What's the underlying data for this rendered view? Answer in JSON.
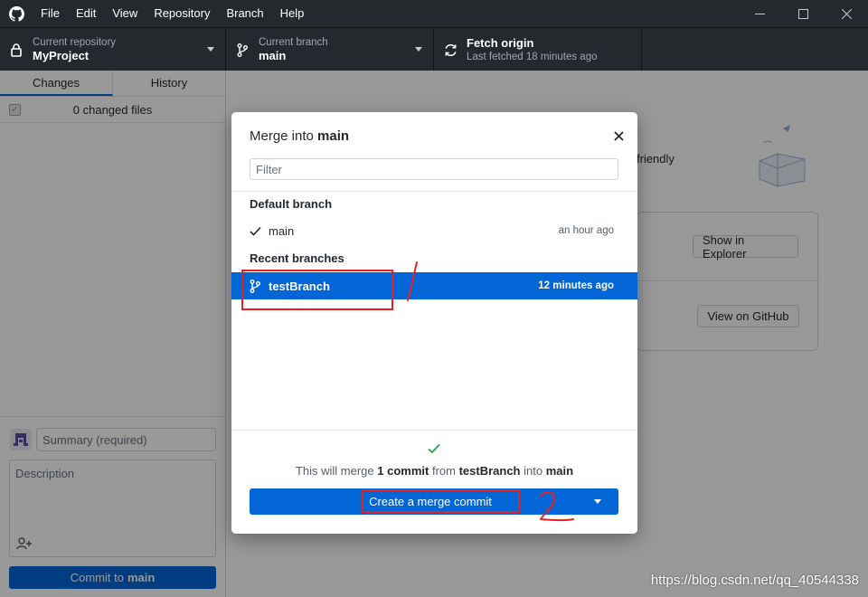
{
  "menu": [
    "File",
    "Edit",
    "View",
    "Repository",
    "Branch",
    "Help"
  ],
  "window_controls": [
    "minimize-icon",
    "maximize-icon",
    "close-icon"
  ],
  "toolbar": {
    "repo_label": "Current repository",
    "repo_value": "MyProject",
    "branch_label": "Current branch",
    "branch_value": "main",
    "fetch_label": "Fetch origin",
    "fetch_sub": "Last fetched 18 minutes ago"
  },
  "sidebar": {
    "tabs": [
      "Changes",
      "History"
    ],
    "changed_files": "0 changed files",
    "summary_placeholder": "Summary (required)",
    "description_placeholder": "Description",
    "commit_prefix": "Commit to",
    "commit_branch": "main"
  },
  "main": {
    "friendly_text": "friendly",
    "show_in_explorer": "Show in Explorer",
    "view_on_github": "View on GitHub"
  },
  "dialog": {
    "title_prefix": "Merge into",
    "title_branch": "main",
    "filter_placeholder": "Filter",
    "default_header": "Default branch",
    "recent_header": "Recent branches",
    "branches": [
      {
        "name": "main",
        "time": "an hour ago",
        "selected": false
      },
      {
        "name": "testBranch",
        "time": "12 minutes ago",
        "selected": true
      }
    ],
    "merge_msg": {
      "part1": "This will merge",
      "count": "1 commit",
      "part2": "from",
      "from": "testBranch",
      "part3": "into",
      "into": "main"
    },
    "merge_button": "Create a merge commit"
  },
  "colors": {
    "accent": "#0366d6",
    "titlebar": "#24292e",
    "annotation": "#e32323",
    "success": "#28a745"
  },
  "watermark": "https://blog.csdn.net/qq_40544338"
}
